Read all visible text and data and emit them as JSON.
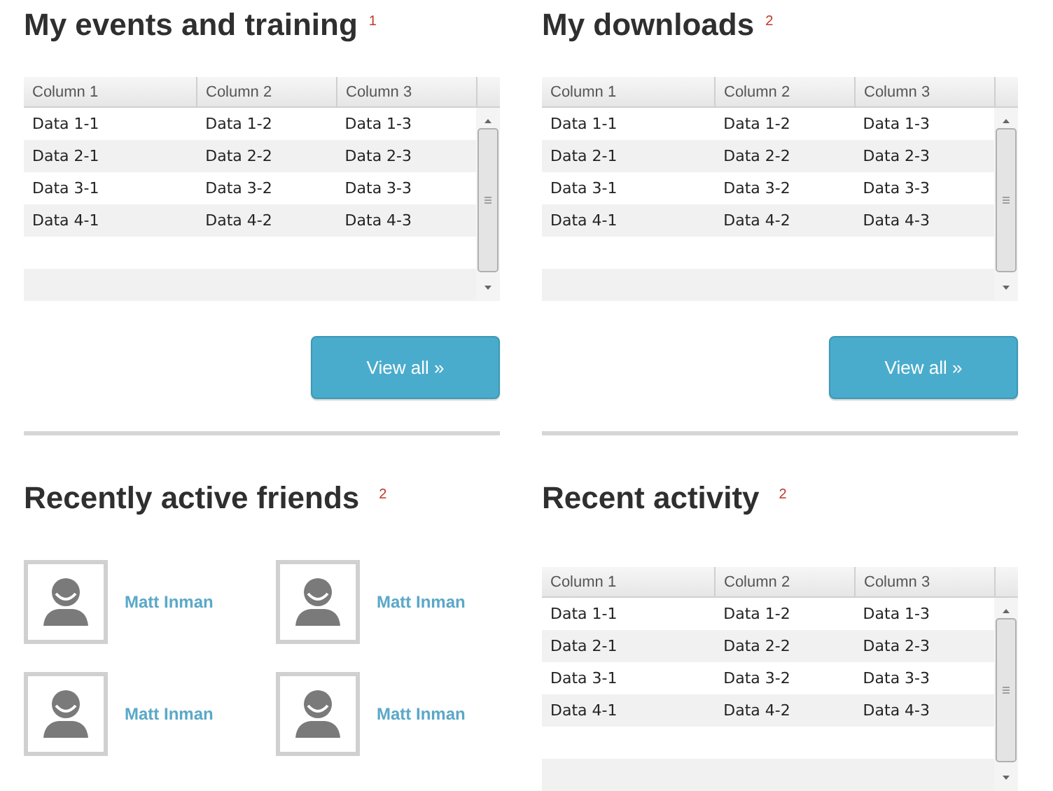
{
  "sections": [
    {
      "kind": "table",
      "title": "My events and training",
      "badge": "1",
      "columns": [
        "Column 1",
        "Column 2",
        "Column 3"
      ],
      "rows": [
        [
          "Data 1-1",
          "Data 1-2",
          "Data 1-3"
        ],
        [
          "Data 2-1",
          "Data 2-2",
          "Data 2-3"
        ],
        [
          "Data 3-1",
          "Data 3-2",
          "Data 3-3"
        ],
        [
          "Data 4-1",
          "Data 4-2",
          "Data 4-3"
        ]
      ],
      "button": "View all »"
    },
    {
      "kind": "table",
      "title": "My downloads",
      "badge": "2",
      "columns": [
        "Column 1",
        "Column 2",
        "Column 3"
      ],
      "rows": [
        [
          "Data 1-1",
          "Data 1-2",
          "Data 1-3"
        ],
        [
          "Data 2-1",
          "Data 2-2",
          "Data 2-3"
        ],
        [
          "Data 3-1",
          "Data 3-2",
          "Data 3-3"
        ],
        [
          "Data 4-1",
          "Data 4-2",
          "Data 4-3"
        ]
      ],
      "button": "View all »"
    },
    {
      "kind": "friends",
      "title": "Recently active friends",
      "badge": "2",
      "friends": [
        {
          "name": "Matt Inman"
        },
        {
          "name": "Matt Inman"
        },
        {
          "name": "Matt Inman"
        },
        {
          "name": "Matt Inman"
        }
      ]
    },
    {
      "kind": "table",
      "title": "Recent activity",
      "badge": "2",
      "columns": [
        "Column 1",
        "Column 2",
        "Column 3"
      ],
      "rows": [
        [
          "Data 1-1",
          "Data 1-2",
          "Data 1-3"
        ],
        [
          "Data 2-1",
          "Data 2-2",
          "Data 2-3"
        ],
        [
          "Data 3-1",
          "Data 3-2",
          "Data 3-3"
        ],
        [
          "Data 4-1",
          "Data 4-2",
          "Data 4-3"
        ]
      ]
    }
  ]
}
